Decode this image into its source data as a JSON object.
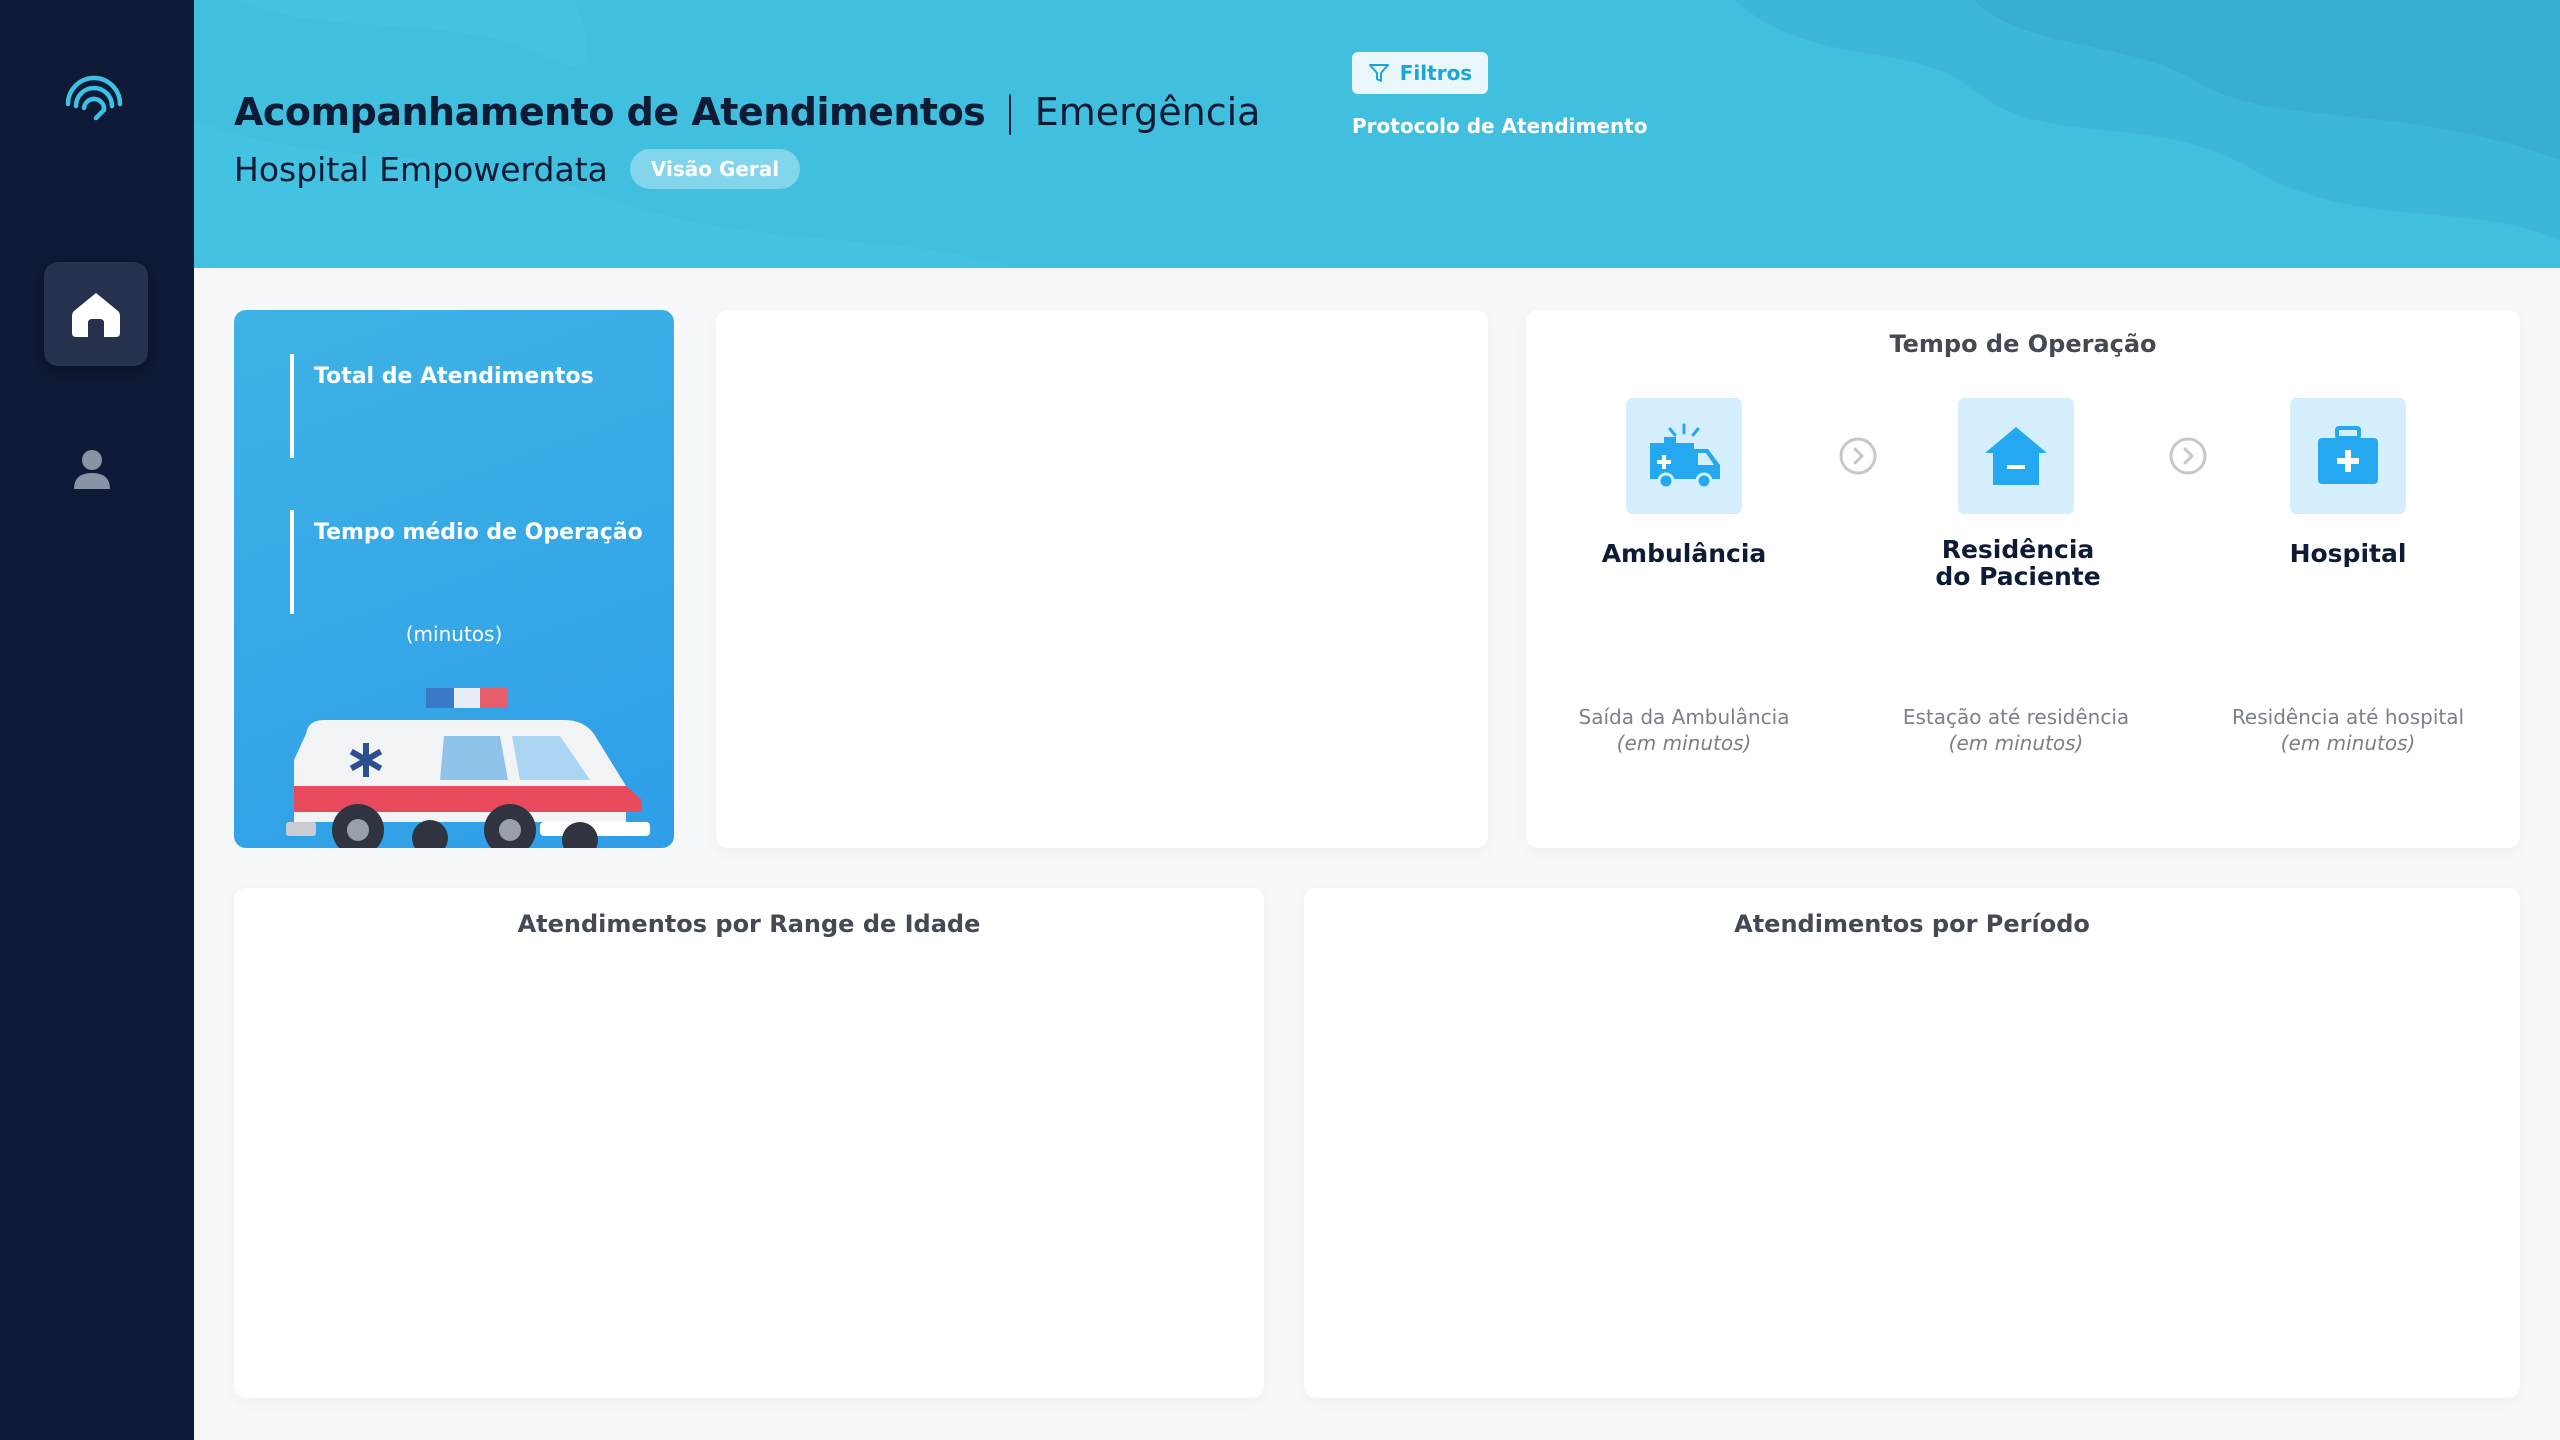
{
  "header": {
    "title": "Acompanhamento de Atendimentos",
    "separator": "|",
    "subtitle": "Emergência",
    "hospital": "Hospital Empowerdata",
    "overview_pill": "Visão Geral",
    "filters_button": "Filtros",
    "protocol_label": "Protocolo de Atendimento",
    "colors": {
      "header_bg": "#40bfdf",
      "sidebar_bg": "#0f1a36",
      "accent": "#1aa7d8"
    }
  },
  "sidebar": {
    "items": [
      {
        "icon": "home-icon",
        "active": true
      },
      {
        "icon": "user-icon",
        "active": false
      }
    ]
  },
  "kpi": {
    "total_label": "Total de Atendimentos",
    "avg_label": "Tempo médio de Operação",
    "unit_note": "(minutos)"
  },
  "operation": {
    "title": "Tempo de Operação",
    "stages": [
      {
        "icon": "ambulance-icon",
        "label": "Ambulância",
        "sub": "Saída da Ambulância",
        "note": "(em minutos)"
      },
      {
        "icon": "house-icon",
        "label_line1": "Residência",
        "label_line2": "do Paciente",
        "sub": "Estação até residência",
        "note": "(em minutos)"
      },
      {
        "icon": "hospital-icon",
        "label": "Hospital",
        "sub": "Residência até hospital",
        "note": "(em minutos)"
      }
    ]
  },
  "charts": {
    "age_title": "Atendimentos por Range de Idade",
    "period_title": "Atendimentos por Período"
  }
}
